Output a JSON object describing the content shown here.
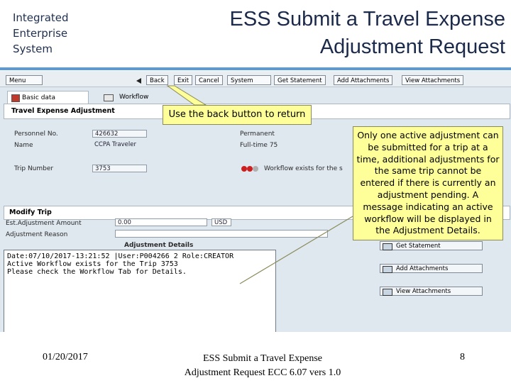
{
  "brand": {
    "text": "Integrated\nEnterprise\nSystem"
  },
  "slide": {
    "title": "ESS Submit a Travel Expense\nAdjustment Request"
  },
  "toolbar": {
    "menu": "Menu",
    "back": "Back",
    "exit": "Exit",
    "cancel": "Cancel",
    "system": "System",
    "get_statement": "Get Statement",
    "add_attachments": "Add Attachments",
    "view_attachments": "View Attachments"
  },
  "tabs": [
    {
      "label": "Basic data"
    },
    {
      "label": "Workflow"
    }
  ],
  "adjustment": {
    "section_title": "Travel Expense Adjustment",
    "personnel_label": "Personnel No.",
    "personnel_value": "426632",
    "name_label": "Name",
    "name_value": "CCPA Traveler",
    "trip_label": "Trip Number",
    "trip_value": "3753",
    "permanent": "Permanent",
    "fulltime": "Full-time 75",
    "workflow_status": "Workflow exists for the s"
  },
  "modify": {
    "section_title": "Modify Trip",
    "est_amount_label": "Est.Adjustment Amount",
    "est_amount_value": "0.00",
    "currency": "USD",
    "reason_label": "Adjustment Reason",
    "details_title": "Adjustment Details",
    "details_lines": [
      "Date:07/10/2017-13:21:52 |User:P004266 2  Role:CREATOR",
      "Active Workflow exists for the Trip 3753",
      "Please check the Workflow Tab for Details."
    ]
  },
  "side_buttons": {
    "get_statement": "Get Statement",
    "add_attachments": "Add Attachments",
    "view_attachments": "View Attachments"
  },
  "callouts": {
    "back": "Use the back button to return",
    "only_one": "Only one active adjustment can be submitted for a trip at a time, additional adjustments for the same trip cannot be entered if there is currently an adjustment pending.  A message indicating an active workflow will be displayed in the Adjustment Details."
  },
  "footer": {
    "date": "01/20/2017",
    "title": "ESS Submit a Travel Expense\nAdjustment Request ECC 6.07 vers 1.0",
    "page": "8"
  },
  "colors": {
    "accent": "#5b9bd5",
    "callout": "#ffff99",
    "light_red": "#cc2020"
  }
}
